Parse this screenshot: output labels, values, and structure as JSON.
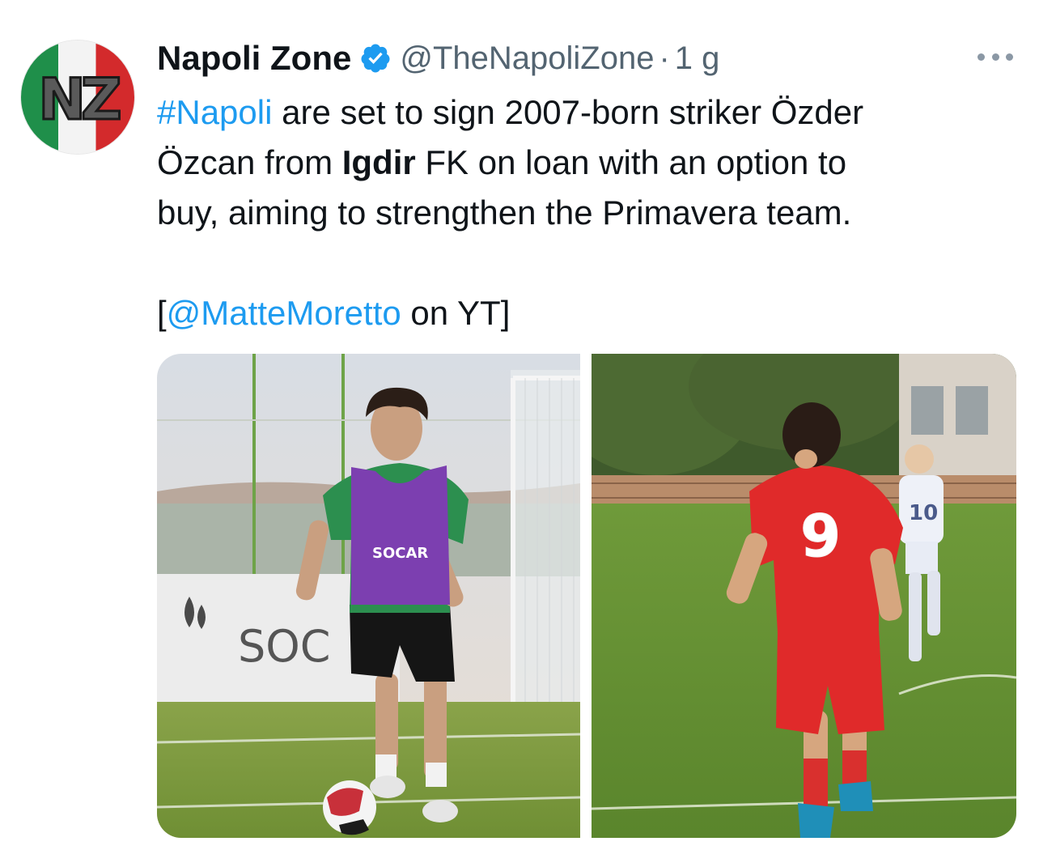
{
  "tweet": {
    "author_name": "Napoli Zone",
    "handle": "@TheNapoliZone",
    "separator": "·",
    "time": "1 g",
    "avatar_text": "NZ",
    "line1_hashtag": "#Napoli",
    "line1_rest": " are set to sign 2007-born striker Özder",
    "line2_pre": "Özcan from ",
    "line2_bold": "Igdir",
    "line2_rest": " FK on loan with an option to",
    "line3": "buy, aiming to strengthen the Primavera team.",
    "credit_open": "[",
    "credit_mention": "@MatteMoretto",
    "credit_rest": " on YT]"
  },
  "media": {
    "left_photo": {
      "bib_sponsor": "SOCAR",
      "banner_text": "SOC"
    },
    "right_photo": {
      "player_number": "9",
      "opponent_number": "10"
    }
  },
  "colors": {
    "link": "#1d9bf0",
    "secondary_text": "#536471",
    "verified": "#1d9bf0"
  }
}
